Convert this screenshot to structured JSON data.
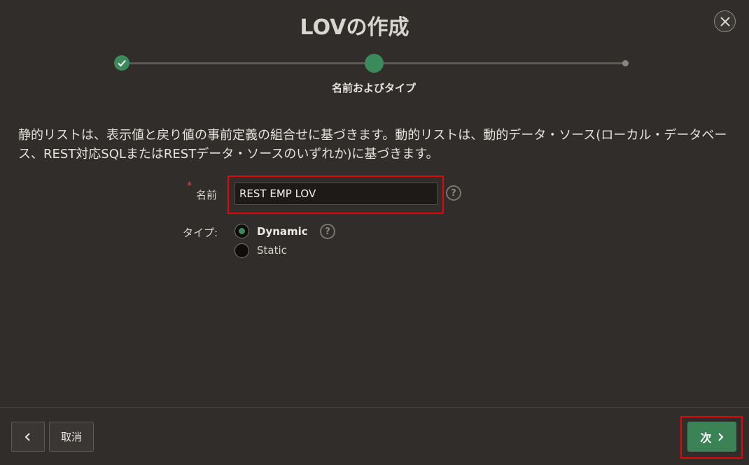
{
  "dialog": {
    "title": "LOVの作成",
    "close_icon": "close-icon"
  },
  "wizard": {
    "current_step_label": "名前およびタイプ",
    "steps": [
      "completed",
      "current",
      "pending"
    ]
  },
  "description": "静的リストは、表示値と戻り値の事前定義の組合せに基づきます。動的リストは、動的データ・ソース(ローカル・データベース、REST対応SQLまたはRESTデータ・ソースのいずれか)に基づきます。",
  "form": {
    "name_label": "名前",
    "required_marker": "*",
    "name_value": "REST EMP LOV",
    "help_glyph": "?",
    "type_label": "タイプ:",
    "type_options": [
      "Dynamic",
      "Static"
    ],
    "type_selected": "Dynamic"
  },
  "footer": {
    "back_icon": "chevron-left-icon",
    "cancel_label": "取消",
    "next_label": "次",
    "next_icon": "chevron-right-icon"
  },
  "colors": {
    "background": "#312d2a",
    "accent": "#3b8a5c",
    "highlight": "#e3070b"
  }
}
